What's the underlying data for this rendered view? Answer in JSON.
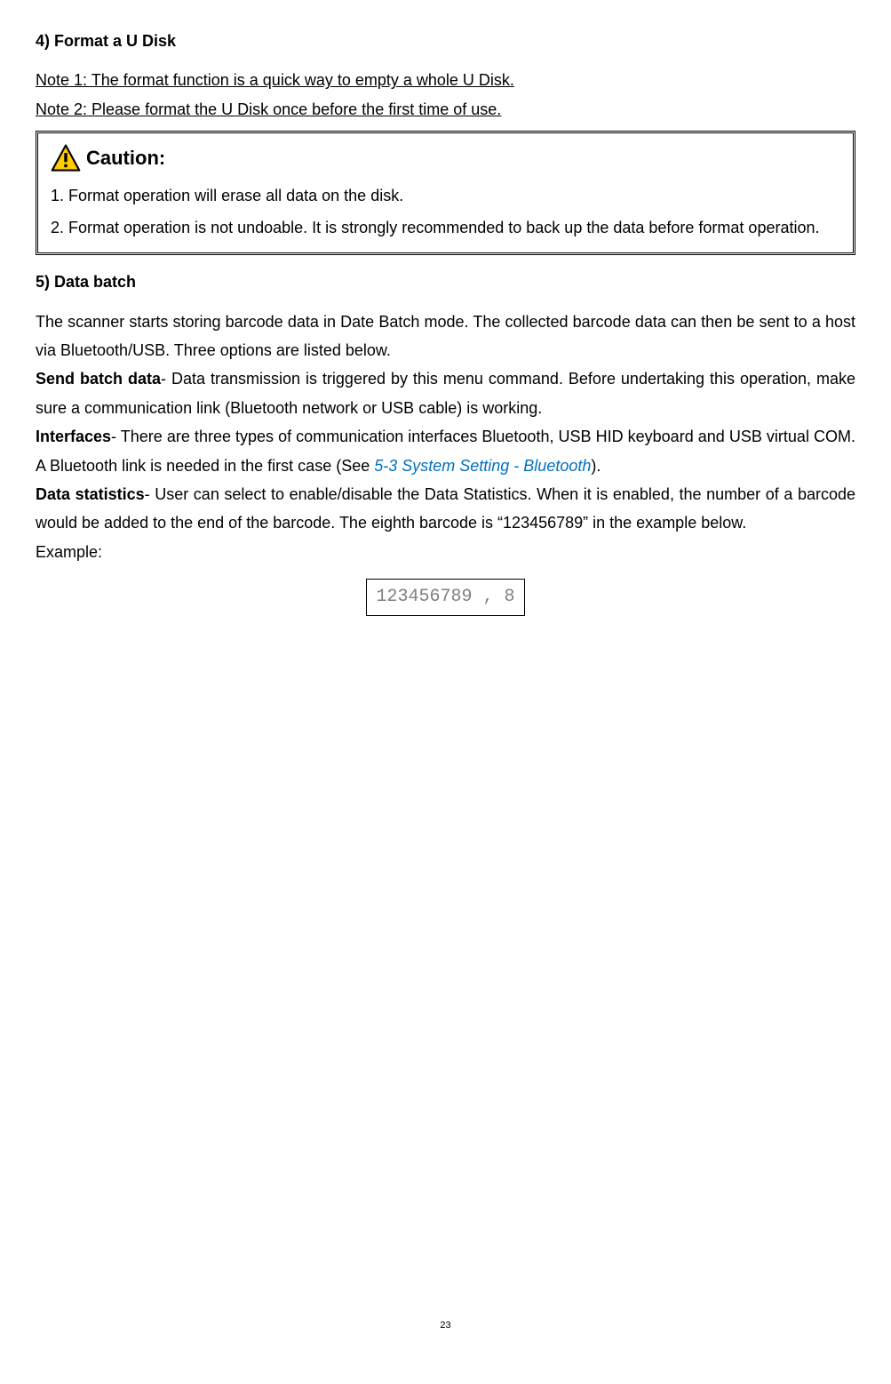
{
  "section4": {
    "heading": "4) Format a U Disk",
    "note1": "Note 1: The format function is a quick way to empty a whole U Disk.  ",
    "note2": "Note 2: Please format the U Disk once before the first time of use."
  },
  "caution": {
    "title": "Caution:",
    "item1": "1. Format operation will erase all data on the disk.",
    "item2": "2. Format operation is not undoable. It is strongly recommended to back up the data before format operation."
  },
  "section5": {
    "heading": "5) Data batch",
    "intro": "The scanner starts storing barcode data in Date Batch mode. The collected barcode data can then be sent to a host via Bluetooth/USB. Three options are listed below.",
    "sendBatchLabel": "Send batch data",
    "sendBatchText": "- Data transmission is triggered by this menu command. Before undertaking this operation, make sure a communication link (Bluetooth network or USB cable) is working.",
    "interfacesLabel": "Interfaces",
    "interfacesText1": "- There are three types of communication interfaces Bluetooth, USB HID keyboard and USB virtual COM. A Bluetooth link is needed in the first case (See ",
    "interfacesLink": "5-3 System Setting - Bluetooth",
    "interfacesText2": ").",
    "dataStatsLabel": "Data statistics",
    "dataStatsText": "- User can select to enable/disable the Data Statistics. When it is enabled, the number of a barcode would be added to the end of the barcode. The eighth barcode is “123456789” in the example below.",
    "exampleLabel": "Example:",
    "exampleValue": "123456789 , 8"
  },
  "pageNumber": "23"
}
